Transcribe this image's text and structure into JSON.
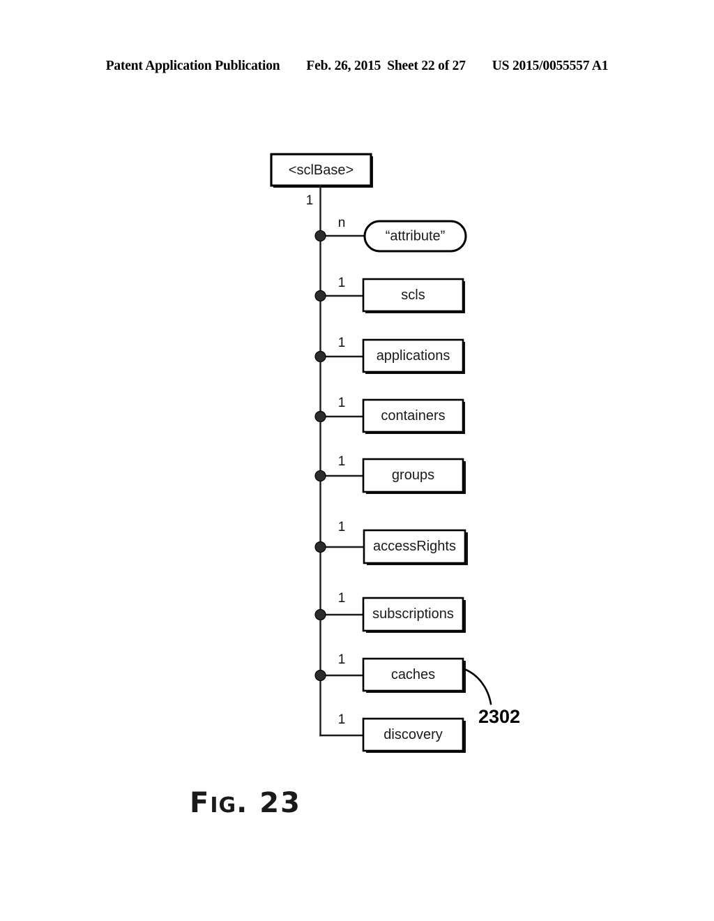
{
  "header": {
    "publication": "Patent Application Publication",
    "date": "Feb. 26, 2015",
    "sheet": "Sheet 22 of 27",
    "number": "US 2015/0055557 A1"
  },
  "figure": {
    "caption_prefix": "F",
    "caption_small": "IG",
    "caption_suffix": ". 23",
    "caption_full": "FIG. 23"
  },
  "diagram": {
    "type": "tree",
    "root": {
      "label": "<sclBase>",
      "shape": "rectangle",
      "multiplicity": "1"
    },
    "children": [
      {
        "label": "“attribute”",
        "shape": "pill",
        "multiplicity": "n",
        "junction": true
      },
      {
        "label": "scls",
        "shape": "rectangle",
        "multiplicity": "1",
        "junction": true
      },
      {
        "label": "applications",
        "shape": "rectangle",
        "multiplicity": "1",
        "junction": true
      },
      {
        "label": "containers",
        "shape": "rectangle",
        "multiplicity": "1",
        "junction": true
      },
      {
        "label": "groups",
        "shape": "rectangle",
        "multiplicity": "1",
        "junction": true
      },
      {
        "label": "accessRights",
        "shape": "rectangle",
        "multiplicity": "1",
        "junction": true
      },
      {
        "label": "subscriptions",
        "shape": "rectangle",
        "multiplicity": "1",
        "junction": true
      },
      {
        "label": "caches",
        "shape": "rectangle",
        "multiplicity": "1",
        "junction": true
      },
      {
        "label": "discovery",
        "shape": "rectangle",
        "multiplicity": "1",
        "junction": false
      }
    ],
    "callout": {
      "reference_numeral": "2302",
      "points_to": "caches"
    }
  },
  "colors": {
    "ink": "#000000",
    "page": "#ffffff",
    "label_ink": "#1a1a1a"
  }
}
